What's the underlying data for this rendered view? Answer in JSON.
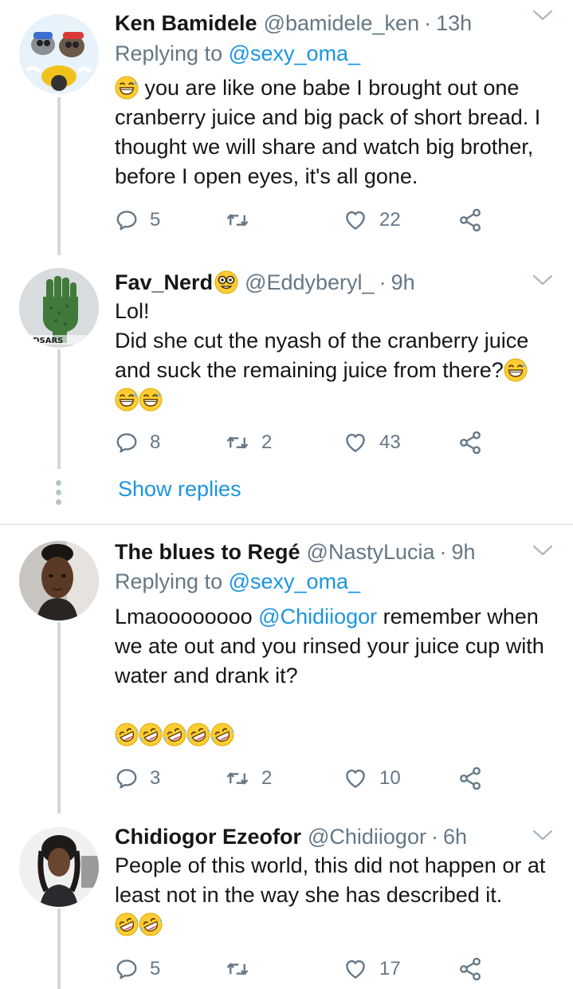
{
  "tweets": [
    {
      "name": "Ken Bamidele",
      "handle": "@bamidele_ken",
      "time": "13h",
      "replying_prefix": "Replying to",
      "replying_to": "@sexy_oma_",
      "text": "you are like one babe I brought out one cranberry juice and big pack of short bread. I thought we will share and watch big brother, before I open eyes, it's all gone.",
      "replies": "5",
      "retweets": "",
      "likes": "22"
    },
    {
      "name": "Fav_Nerd",
      "handle": "@Eddyberyl_",
      "time": "9h",
      "text_line1": "Lol!",
      "text_line2": "Did she cut the nyash of the cranberry juice and suck the remaining juice from there?",
      "replies": "8",
      "retweets": "2",
      "likes": "43",
      "avatar_text": "ENDSARS"
    },
    {
      "name": "The blues to Regé",
      "handle": "@NastyLucia",
      "time": "9h",
      "replying_prefix": "Replying to",
      "replying_to": "@sexy_oma_",
      "text_before": "Lmaoooooooo",
      "text_mention": "@Chidiiogor",
      "text_after": "remember when we ate out and you rinsed your juice cup with water and drank it?",
      "replies": "3",
      "retweets": "2",
      "likes": "10"
    },
    {
      "name": "Chidiogor Ezeofor",
      "handle": "@Chidiiogor",
      "time": "6h",
      "text": "People of this world, this did not happen or at least not in the way she has described it.",
      "replies": "5",
      "retweets": "",
      "likes": "17"
    }
  ],
  "show_replies_label": "Show replies",
  "separator": "·",
  "icons": {
    "reply": "reply-icon",
    "retweet": "retweet-icon",
    "like": "heart-icon",
    "share": "share-icon",
    "caret": "chevron-down-icon",
    "emoji_grin": "grinning-sweat-emoji",
    "emoji_rofl": "rolling-laughing-emoji"
  },
  "colors": {
    "link": "#1b95e0",
    "muted": "#657786",
    "text": "#14171a",
    "thread_line": "#cfd9de"
  }
}
